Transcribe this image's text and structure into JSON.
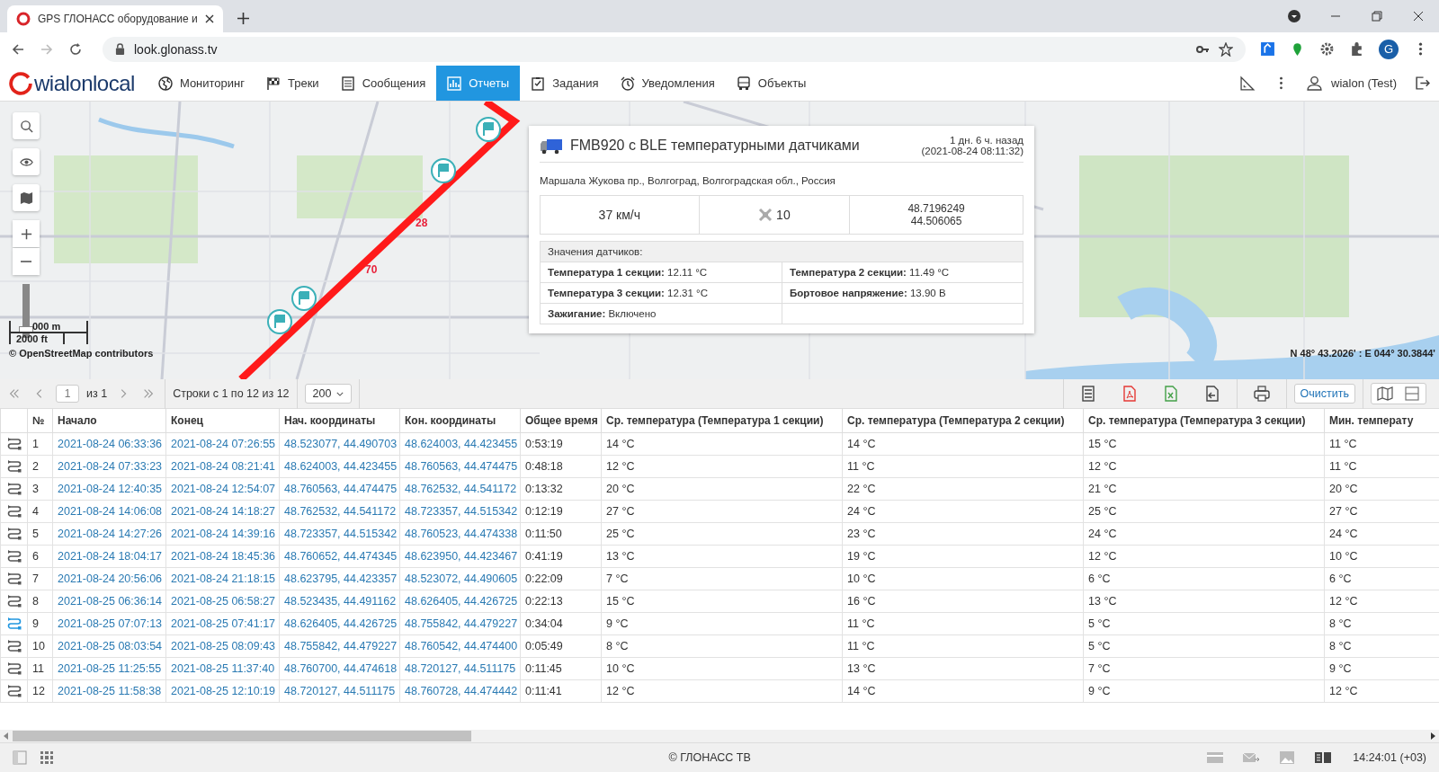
{
  "browser": {
    "tab_title": "GPS ГЛОНАСС оборудование и",
    "url": "look.glonass.tv",
    "profile_initial": "G"
  },
  "app": {
    "logo": "wialonlocal",
    "nav": [
      {
        "label": "Мониторинг",
        "kind": "globe",
        "selected": false
      },
      {
        "label": "Треки",
        "kind": "flag",
        "selected": false
      },
      {
        "label": "Сообщения",
        "kind": "list",
        "selected": false
      },
      {
        "label": "Отчеты",
        "kind": "chart",
        "selected": true
      },
      {
        "label": "Задания",
        "kind": "task",
        "selected": false
      },
      {
        "label": "Уведомления",
        "kind": "alarm",
        "selected": false
      },
      {
        "label": "Объекты",
        "kind": "bus",
        "selected": false
      }
    ],
    "user": "wialon (Test)"
  },
  "map": {
    "zoom_slider": {
      "level": 0.1
    },
    "route_labels": [
      "28",
      "70"
    ],
    "scale": [
      "000 m",
      "2000 ft"
    ],
    "attribution": "© OpenStreetMap contributors",
    "coordinates": "N 48° 43.2026' : E 044° 30.3844'"
  },
  "unit_popup": {
    "title": "FMB920 с BLE температурными датчиками",
    "ago": "1 дн. 6 ч. назад",
    "time": "(2021-08-24 08:11:32)",
    "address": "Маршала Жукова пр., Волгоград, Волгоградская обл., Россия",
    "speed": "37 км/ч",
    "satellites": "10",
    "lat": "48.7196249",
    "lon": "44.506065",
    "sensors_title": "Значения датчиков:",
    "sensors": [
      "**Температура 1 секции:** 12.11 °C",
      "**Температура 2 секции:** 11.49 °C",
      "**Температура 3 секции:** 12.31 °C",
      "**Бортовое напряжение:** 13.90 В",
      "**Зажигание:** Включено"
    ]
  },
  "toolbar": {
    "page": "1",
    "page_of": "из 1",
    "rows_info": "Строки с 1 по 12 из 12",
    "page_size": "200",
    "clear_button": "Очистить"
  },
  "table": {
    "columns": [
      "№",
      "Начало",
      "Конец",
      "Нач. координаты",
      "Кон. координаты",
      "Общее время",
      "Ср. температура (Температура 1 секции)",
      "Ср. температура (Температура 2 секции)",
      "Ср. температура (Температура 3 секции)",
      "Мин. температу"
    ],
    "rows": [
      {
        "selected": false,
        "cells": [
          "1",
          "2021-08-24 06:33:36",
          "2021-08-24 07:26:55",
          "48.523077, 44.490703",
          "48.624003, 44.423455",
          "0:53:19",
          "14 °C",
          "14 °C",
          "15 °C",
          "11 °C"
        ]
      },
      {
        "selected": false,
        "cells": [
          "2",
          "2021-08-24 07:33:23",
          "2021-08-24 08:21:41",
          "48.624003, 44.423455",
          "48.760563, 44.474475",
          "0:48:18",
          "12 °C",
          "11 °C",
          "12 °C",
          "11 °C"
        ]
      },
      {
        "selected": false,
        "cells": [
          "3",
          "2021-08-24 12:40:35",
          "2021-08-24 12:54:07",
          "48.760563, 44.474475",
          "48.762532, 44.541172",
          "0:13:32",
          "20 °C",
          "22 °C",
          "21 °C",
          "20 °C"
        ]
      },
      {
        "selected": false,
        "cells": [
          "4",
          "2021-08-24 14:06:08",
          "2021-08-24 14:18:27",
          "48.762532, 44.541172",
          "48.723357, 44.515342",
          "0:12:19",
          "27 °C",
          "24 °C",
          "25 °C",
          "27 °C"
        ]
      },
      {
        "selected": false,
        "cells": [
          "5",
          "2021-08-24 14:27:26",
          "2021-08-24 14:39:16",
          "48.723357, 44.515342",
          "48.760523, 44.474338",
          "0:11:50",
          "25 °C",
          "23 °C",
          "24 °C",
          "24 °C"
        ]
      },
      {
        "selected": false,
        "cells": [
          "6",
          "2021-08-24 18:04:17",
          "2021-08-24 18:45:36",
          "48.760652, 44.474345",
          "48.623950, 44.423467",
          "0:41:19",
          "13 °C",
          "19 °C",
          "12 °C",
          "10 °C"
        ]
      },
      {
        "selected": false,
        "cells": [
          "7",
          "2021-08-24 20:56:06",
          "2021-08-24 21:18:15",
          "48.623795, 44.423357",
          "48.523072, 44.490605",
          "0:22:09",
          "7 °C",
          "10 °C",
          "6 °C",
          "6 °C"
        ]
      },
      {
        "selected": false,
        "cells": [
          "8",
          "2021-08-25 06:36:14",
          "2021-08-25 06:58:27",
          "48.523435, 44.491162",
          "48.626405, 44.426725",
          "0:22:13",
          "15 °C",
          "16 °C",
          "13 °C",
          "12 °C"
        ]
      },
      {
        "selected": true,
        "cells": [
          "9",
          "2021-08-25 07:07:13",
          "2021-08-25 07:41:17",
          "48.626405, 44.426725",
          "48.755842, 44.479227",
          "0:34:04",
          "9 °C",
          "11 °C",
          "5 °C",
          "8 °C"
        ]
      },
      {
        "selected": false,
        "cells": [
          "10",
          "2021-08-25 08:03:54",
          "2021-08-25 08:09:43",
          "48.755842, 44.479227",
          "48.760542, 44.474400",
          "0:05:49",
          "8 °C",
          "11 °C",
          "5 °C",
          "8 °C"
        ]
      },
      {
        "selected": false,
        "cells": [
          "11",
          "2021-08-25 11:25:55",
          "2021-08-25 11:37:40",
          "48.760700, 44.474618",
          "48.720127, 44.511175",
          "0:11:45",
          "10 °C",
          "13 °C",
          "7 °C",
          "9 °C"
        ]
      },
      {
        "selected": false,
        "cells": [
          "12",
          "2021-08-25 11:58:38",
          "2021-08-25 12:10:19",
          "48.720127, 44.511175",
          "48.760728, 44.474442",
          "0:11:41",
          "12 °C",
          "14 °C",
          "9 °C",
          "12 °C"
        ]
      }
    ]
  },
  "status_bar": {
    "copyright": "© ГЛОНАСС ТВ",
    "time": "14:24:01 (+03)"
  }
}
